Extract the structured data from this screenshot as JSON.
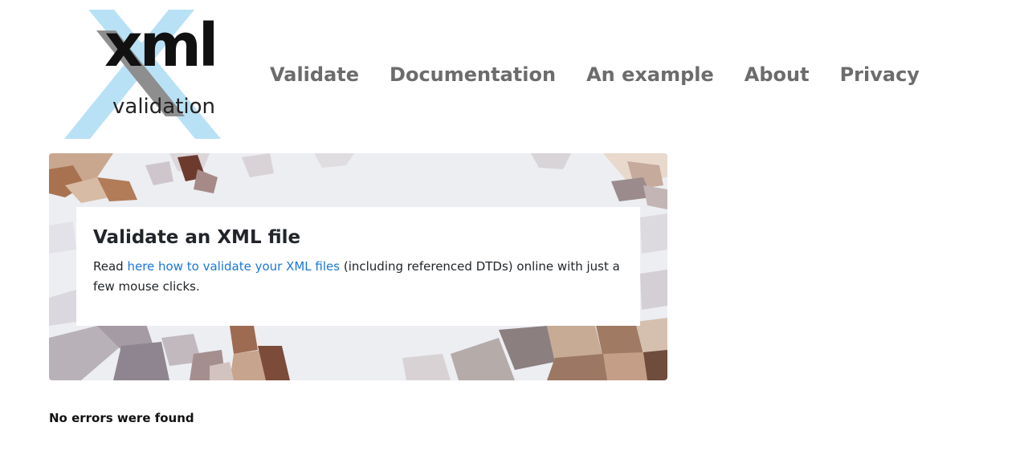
{
  "logo": {
    "word": "xml",
    "subword": "validation",
    "accent_color": "#b9e1f6"
  },
  "nav": {
    "items": [
      {
        "label": "Validate"
      },
      {
        "label": "Documentation"
      },
      {
        "label": "An example"
      },
      {
        "label": "About"
      },
      {
        "label": "Privacy"
      }
    ]
  },
  "hero": {
    "title": "Validate an XML file",
    "text_before": "Read ",
    "link_text": "here how to validate your XML files",
    "text_after": " (including referenced DTDs) online with just a few mouse clicks.",
    "link_color": "#1a78d6"
  },
  "result": {
    "status": "No errors were found"
  }
}
